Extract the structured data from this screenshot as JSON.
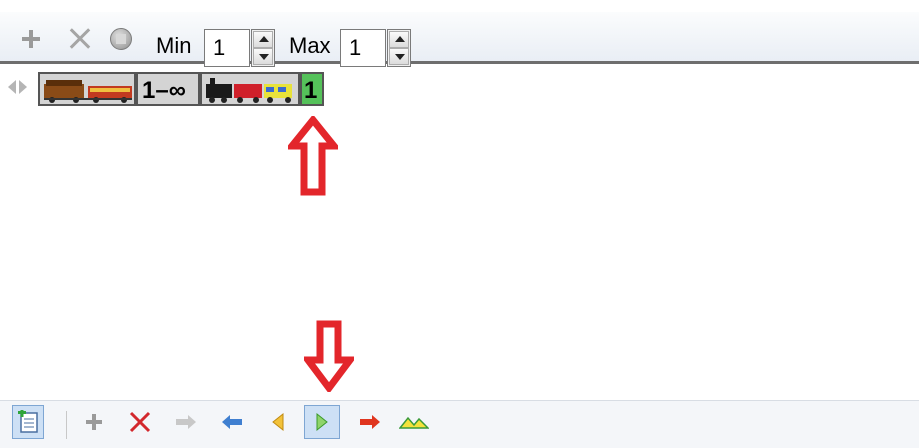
{
  "top_toolbar": {
    "icons": [
      "plus-icon",
      "close-icon",
      "stop-icon"
    ],
    "min_label": "Min",
    "min_value": "1",
    "max_label": "Max",
    "max_value": "1"
  },
  "train_row": {
    "icon": "collapse-expand-icon",
    "groups": [
      {
        "icon": "freight-wagons-icon",
        "count": "1–∞"
      },
      {
        "icon": "locomotive-train-icon",
        "count": "1"
      }
    ]
  },
  "annotations": {
    "arrow_up": "red-up-arrow",
    "arrow_down": "red-down-arrow"
  },
  "bottom_toolbar": {
    "icons": [
      "add-page-icon",
      "plus-icon",
      "delete-icon",
      "arrow-right-icon",
      "arrow-left-icon",
      "play-left-icon",
      "play-right-icon",
      "red-arrow-right-icon",
      "mountain-icon"
    ],
    "selected": "play-right-icon"
  },
  "colors": {
    "green_count": "#55c25a",
    "red_annotation": "#e3262b",
    "selected_bg": "#cde0f5"
  }
}
